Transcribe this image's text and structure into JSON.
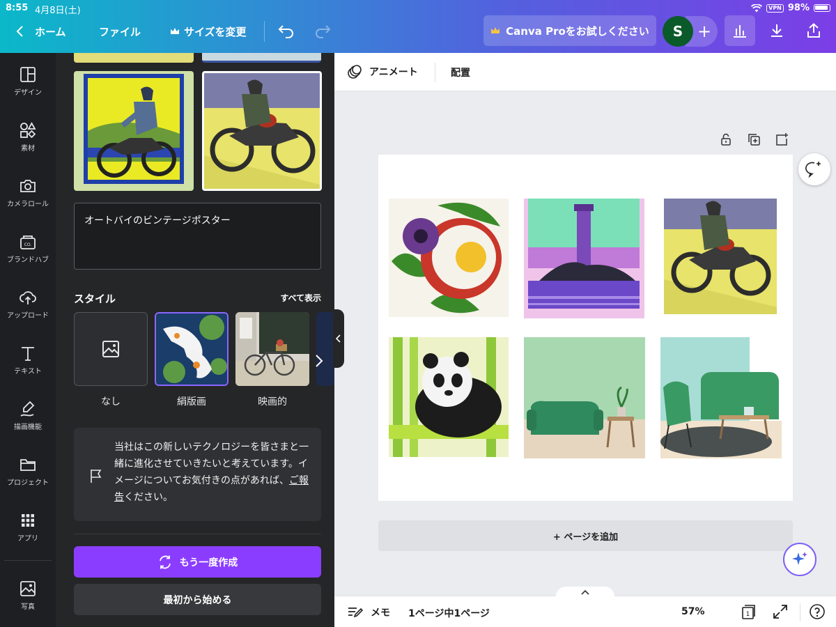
{
  "status": {
    "time": "8:55",
    "date": "4月8日(土)",
    "vpn": "VPN",
    "battery": "98%"
  },
  "header": {
    "home": "ホーム",
    "file": "ファイル",
    "resize": "サイズを変更",
    "try_pro": "Canva Proをお試しください",
    "avatar_initial": "S"
  },
  "rail": {
    "items": [
      {
        "label": "デザイン",
        "icon": "layout-icon"
      },
      {
        "label": "素材",
        "icon": "elements-icon"
      },
      {
        "label": "カメラロール",
        "icon": "camera-icon"
      },
      {
        "label": "ブランドハブ",
        "icon": "brand-icon"
      },
      {
        "label": "アップロード",
        "icon": "upload-icon"
      },
      {
        "label": "テキスト",
        "icon": "text-icon"
      },
      {
        "label": "描画機能",
        "icon": "draw-icon"
      },
      {
        "label": "プロジェクト",
        "icon": "folder-icon"
      },
      {
        "label": "アプリ",
        "icon": "apps-icon"
      },
      {
        "label": "写真",
        "icon": "photo-icon"
      }
    ]
  },
  "panel": {
    "prompt": "オートバイのビンテージポスター",
    "style_heading": "スタイル",
    "see_all": "すべて表示",
    "styles": [
      {
        "label": "なし"
      },
      {
        "label": "絹版画"
      },
      {
        "label": "映画的"
      }
    ],
    "notice_before_link": "当社はこの新しいテクノロジーを皆さまと一緒に進化させていきたいと考えています。イメージについてお気付きの点があれば、",
    "notice_link": "ご報告",
    "notice_after_link": "ください。",
    "regenerate": "もう一度作成",
    "start_over": "最初から始める"
  },
  "editor": {
    "animate": "アニメート",
    "position": "配置",
    "add_page": "+ ページを追加"
  },
  "footer": {
    "memo": "メモ",
    "page_count": "1ページ中1ページ",
    "zoom": "57%",
    "page_number": "1"
  },
  "colors": {
    "accent": "#8b3dff",
    "panel_bg": "#252627",
    "rail_bg": "#1e1f22"
  }
}
